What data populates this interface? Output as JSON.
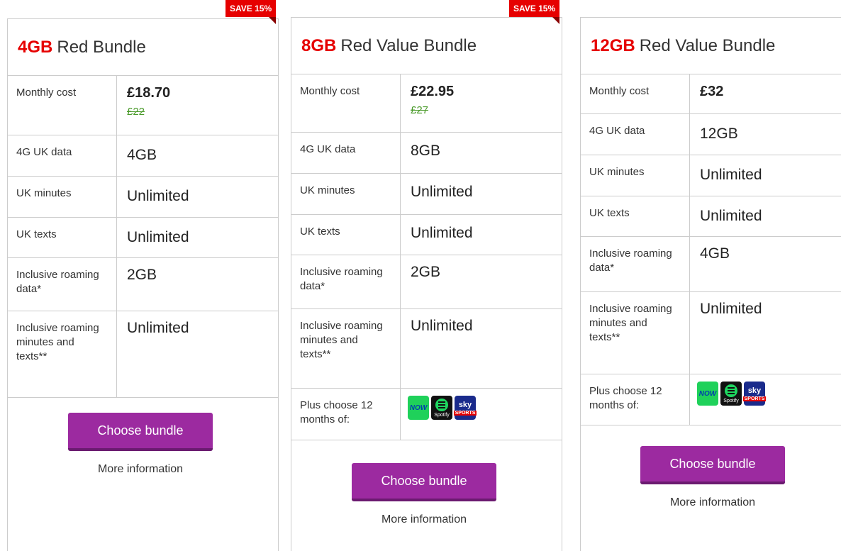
{
  "cards": [
    {
      "gb": "4GB",
      "name": "Red Bundle",
      "badge": "SAVE 15%",
      "rows": {
        "monthly_cost_label": "Monthly cost",
        "price": "£18.70",
        "old_price": "£22",
        "data_label": "4G UK data",
        "data": "4GB",
        "minutes_label": "UK minutes",
        "minutes": "Unlimited",
        "texts_label": "UK texts",
        "texts": "Unlimited",
        "roaming_data_label": "Inclusive roaming data*",
        "roaming_data": "2GB",
        "roaming_min_label": "Inclusive roaming minutes and texts**",
        "roaming_min": "Unlimited"
      },
      "button": "Choose bundle",
      "more": "More information"
    },
    {
      "gb": "8GB",
      "name": "Red Value Bundle",
      "badge": "SAVE 15%",
      "rows": {
        "monthly_cost_label": "Monthly cost",
        "price": "£22.95",
        "old_price": "£27",
        "data_label": "4G UK data",
        "data": "8GB",
        "minutes_label": "UK minutes",
        "minutes": "Unlimited",
        "texts_label": "UK texts",
        "texts": "Unlimited",
        "roaming_data_label": "Inclusive roaming data*",
        "roaming_data": "2GB",
        "roaming_min_label": "Inclusive roaming minutes and texts**",
        "roaming_min": "Unlimited",
        "plus_label": "Plus choose 12 months of:"
      },
      "button": "Choose bundle",
      "more": "More information"
    },
    {
      "gb": "12GB",
      "name": "Red Value Bundle",
      "rows": {
        "monthly_cost_label": "Monthly cost",
        "price": "£32",
        "data_label": "4G UK data",
        "data": "12GB",
        "minutes_label": "UK minutes",
        "minutes": "Unlimited",
        "texts_label": "UK texts",
        "texts": "Unlimited",
        "roaming_data_label": "Inclusive roaming data*",
        "roaming_data": "4GB",
        "roaming_min_label": "Inclusive roaming minutes and texts**",
        "roaming_min": "Unlimited",
        "plus_label": "Plus choose 12 months of:"
      },
      "button": "Choose bundle",
      "more": "More information"
    }
  ],
  "logos": {
    "now": "NOW",
    "spotify": "Spotify",
    "sky": "sky",
    "sky_sub": "SPORTS"
  },
  "colors": {
    "brand_red": "#e60000",
    "button_purple": "#9c2aa0",
    "old_price_green": "#4a9a2a"
  }
}
